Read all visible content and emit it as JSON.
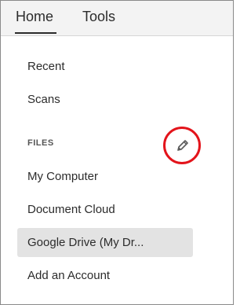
{
  "tabs": {
    "home": "Home",
    "tools": "Tools"
  },
  "nav": {
    "recent": "Recent",
    "scans": "Scans"
  },
  "files": {
    "section_label": "FILES",
    "edit_icon": "pencil-icon",
    "items": [
      "My Computer",
      "Document Cloud",
      "Google Drive (My Dr...",
      "Add an Account"
    ],
    "selected_index": 2
  },
  "colors": {
    "highlight_ring": "#e3141b",
    "selected_bg": "#e3e3e3",
    "tabbar_bg": "#f3f3f3"
  }
}
